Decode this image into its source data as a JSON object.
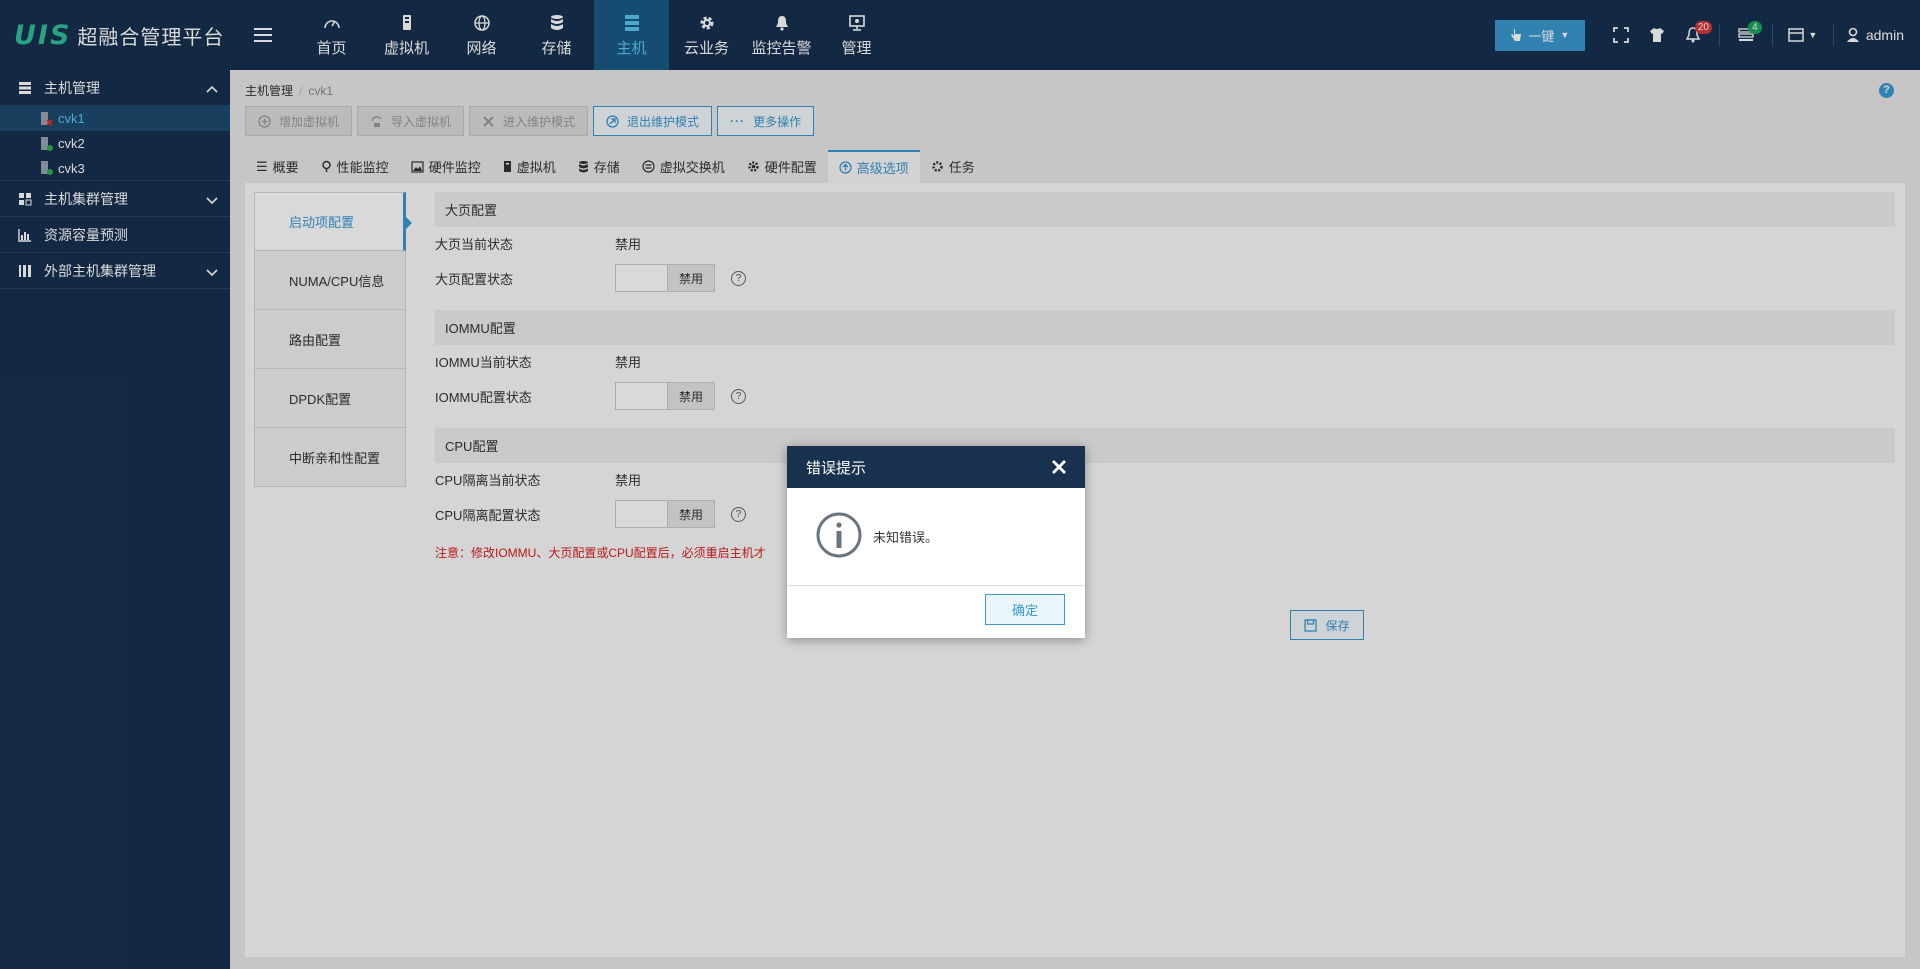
{
  "app": {
    "logo_mark": "UIS",
    "logo_text": "超融合管理平台"
  },
  "nav": {
    "items": [
      {
        "label": "首页",
        "icon": "dashboard-icon"
      },
      {
        "label": "虚拟机",
        "icon": "vm-icon"
      },
      {
        "label": "网络",
        "icon": "globe-icon"
      },
      {
        "label": "存储",
        "icon": "database-icon"
      },
      {
        "label": "主机",
        "icon": "server-icon"
      },
      {
        "label": "云业务",
        "icon": "gear-icon"
      },
      {
        "label": "监控告警",
        "icon": "bell-icon"
      },
      {
        "label": "管理",
        "icon": "monitor-icon"
      }
    ],
    "active": "主机"
  },
  "topright": {
    "oneclick_label": "一键",
    "alerts_count": "20",
    "tasks_count": "4",
    "user": "admin"
  },
  "sidebar": {
    "host_mgmt": "主机管理",
    "hosts": [
      "cvk1",
      "cvk2",
      "cvk3"
    ],
    "cluster_mgmt": "主机集群管理",
    "capacity": "资源容量预测",
    "external_cluster": "外部主机集群管理"
  },
  "breadcrumb": {
    "root": "主机管理",
    "current": "cvk1"
  },
  "toolbar": {
    "add_vm": "增加虚拟机",
    "import_vm": "导入虚拟机",
    "enter_maint": "进入维护模式",
    "exit_maint": "退出维护模式",
    "more": "更多操作"
  },
  "tabs": {
    "overview": "概要",
    "perf": "性能监控",
    "hw_monitor": "硬件监控",
    "vm": "虚拟机",
    "storage": "存储",
    "vswitch": "虚拟交换机",
    "hw_config": "硬件配置",
    "advanced": "高级选项",
    "tasks": "任务"
  },
  "vtabs": {
    "boot": "启动项配置",
    "numa": "NUMA/CPU信息",
    "route": "路由配置",
    "dpdk": "DPDK配置",
    "irq": "中断亲和性配置"
  },
  "config": {
    "hugepage_title": "大页配置",
    "hugepage_current_label": "大页当前状态",
    "hugepage_current_value": "禁用",
    "hugepage_config_label": "大页配置状态",
    "hugepage_switch": "禁用",
    "iommu_title": "IOMMU配置",
    "iommu_current_label": "IOMMU当前状态",
    "iommu_current_value": "禁用",
    "iommu_config_label": "IOMMU配置状态",
    "iommu_switch": "禁用",
    "cpu_title": "CPU配置",
    "cpu_current_label": "CPU隔离当前状态",
    "cpu_current_value": "禁用",
    "cpu_config_label": "CPU隔离配置状态",
    "cpu_switch": "禁用",
    "note": "注意：修改IOMMU、大页配置或CPU配置后，必须重启主机才",
    "save": "保存"
  },
  "modal": {
    "title": "错误提示",
    "message": "未知错误。",
    "ok": "确定"
  },
  "colors": {
    "topbar": "#17314f",
    "accent": "#3a98d0",
    "active_nav": "#1b5a86",
    "warning_text": "#d82020"
  }
}
